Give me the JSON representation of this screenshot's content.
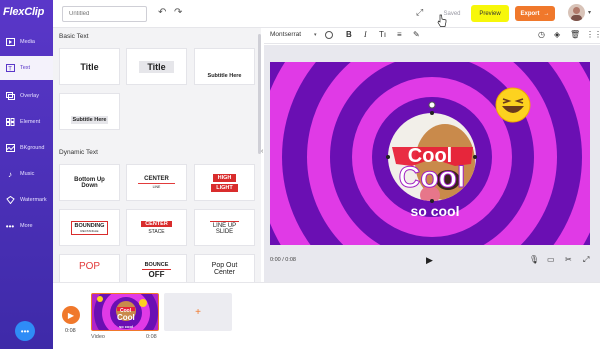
{
  "app": {
    "logo": "FlexClip"
  },
  "sidebar": {
    "items": [
      {
        "label": "Media",
        "icon": "media-icon"
      },
      {
        "label": "Text",
        "icon": "text-icon"
      },
      {
        "label": "Overlay",
        "icon": "overlay-icon"
      },
      {
        "label": "Element",
        "icon": "element-icon"
      },
      {
        "label": "BKground",
        "icon": "background-icon"
      },
      {
        "label": "Music",
        "icon": "music-icon"
      },
      {
        "label": "Watermark",
        "icon": "watermark-icon"
      },
      {
        "label": "More",
        "icon": "more-icon"
      }
    ]
  },
  "header": {
    "title_placeholder": "Untitled",
    "saved_label": "Saved",
    "preview_label": "Preview",
    "export_label": "Export",
    "export_arrow": "→"
  },
  "text_panel": {
    "basic_title": "Basic Text",
    "basic_cards": [
      "Title",
      "Title",
      "Subtitle Here",
      "Subtitle Here"
    ],
    "dynamic_title": "Dynamic Text",
    "dynamic_cards": [
      {
        "line1": "Bottom Up",
        "line2": "Down"
      },
      {
        "line1": "CENTER",
        "line2": "LINE"
      },
      {
        "line1": "HIGH",
        "line2": "LIGHT"
      },
      {
        "line1": "BOUNDING",
        "line2": "RECTANGLE"
      },
      {
        "line1": "CENTER",
        "line2": "STACE"
      },
      {
        "line1": "LINE UP",
        "line2": "SLIDE"
      },
      {
        "line1": "POP",
        "line2": ""
      },
      {
        "line1": "BOUNCE",
        "line2": "OFF"
      },
      {
        "line1": "Pop Out",
        "line2": "Center"
      }
    ]
  },
  "editor_toolbar": {
    "font": "Montserrat",
    "bold": "B",
    "italic": "I"
  },
  "canvas": {
    "text_cool_box": "Cool",
    "text_cool_big": "Cool",
    "text_so_cool": "so cool",
    "colors": {
      "ring_dark": "#6a0fb3",
      "ring_light": "#d22fe0",
      "accent": "#f0782b",
      "highlight": "#f7f70a"
    }
  },
  "player": {
    "time": "0:00 / 0:08"
  },
  "timeline": {
    "total": "0:08",
    "clip_label": "Video",
    "clip_duration": "0:08",
    "add_label": "+"
  }
}
